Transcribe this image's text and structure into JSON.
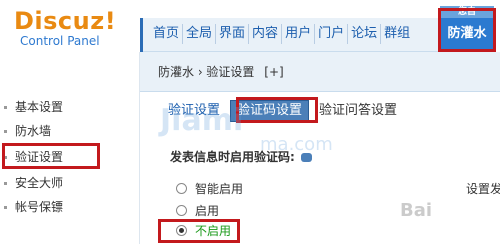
{
  "logo": {
    "main": "Discuz!",
    "sub": "Control Panel"
  },
  "topnav": {
    "items": [
      "首页",
      "全局",
      "界面",
      "内容",
      "用户",
      "门户",
      "论坛",
      "群组"
    ]
  },
  "anti_spam_tab": {
    "top_text": "您自",
    "label": "防灌水"
  },
  "sidebar": {
    "items": [
      "基本设置",
      "防水墙",
      "验证设置",
      "安全大师",
      "帐号保镖"
    ]
  },
  "breadcrumb": {
    "path": "防灌水 › 验证设置",
    "add_label": "[+]"
  },
  "subtabs": {
    "tab1": "验证设置",
    "tab2": "验证码设置",
    "tab3": "验证问答设置"
  },
  "question": {
    "label": "发表信息时启用验证码:"
  },
  "radio_options": [
    {
      "label": "智能启用",
      "checked": false
    },
    {
      "label": "启用",
      "checked": false
    },
    {
      "label": "不启用",
      "checked": true
    }
  ],
  "right_note": "设置发",
  "colors": {
    "highlight_red": "#c3191d",
    "tab_blue": "#2b7ad0",
    "nav_blue": "#1d5fae"
  }
}
